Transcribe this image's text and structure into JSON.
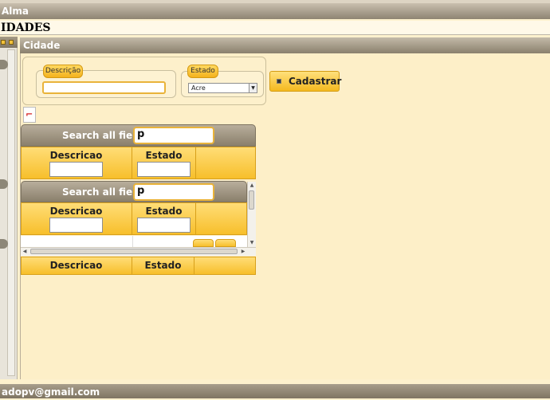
{
  "window": {
    "title": "Alma"
  },
  "page": {
    "heading": "IDADES"
  },
  "panel": {
    "title": "Cidade"
  },
  "form": {
    "descricao_label": "Descrição",
    "descricao_value": "",
    "estado_label": "Estado",
    "estado_value": "Acre",
    "submit_label": "Cadastrar"
  },
  "grid1": {
    "search_label": "Search all fields:",
    "search_value": "p",
    "columns": [
      "Descricao",
      "Estado"
    ]
  },
  "grid2": {
    "search_label": "Search all fields:",
    "search_value": "p",
    "columns": [
      "Descricao",
      "Estado"
    ],
    "footer_columns": [
      "Descricao",
      "Estado"
    ]
  },
  "statusbar": {
    "text": "adopv@gmail.com"
  },
  "colors": {
    "accent": "#f4b91f",
    "header": "#8e8472",
    "background": "#fdf1cd"
  }
}
